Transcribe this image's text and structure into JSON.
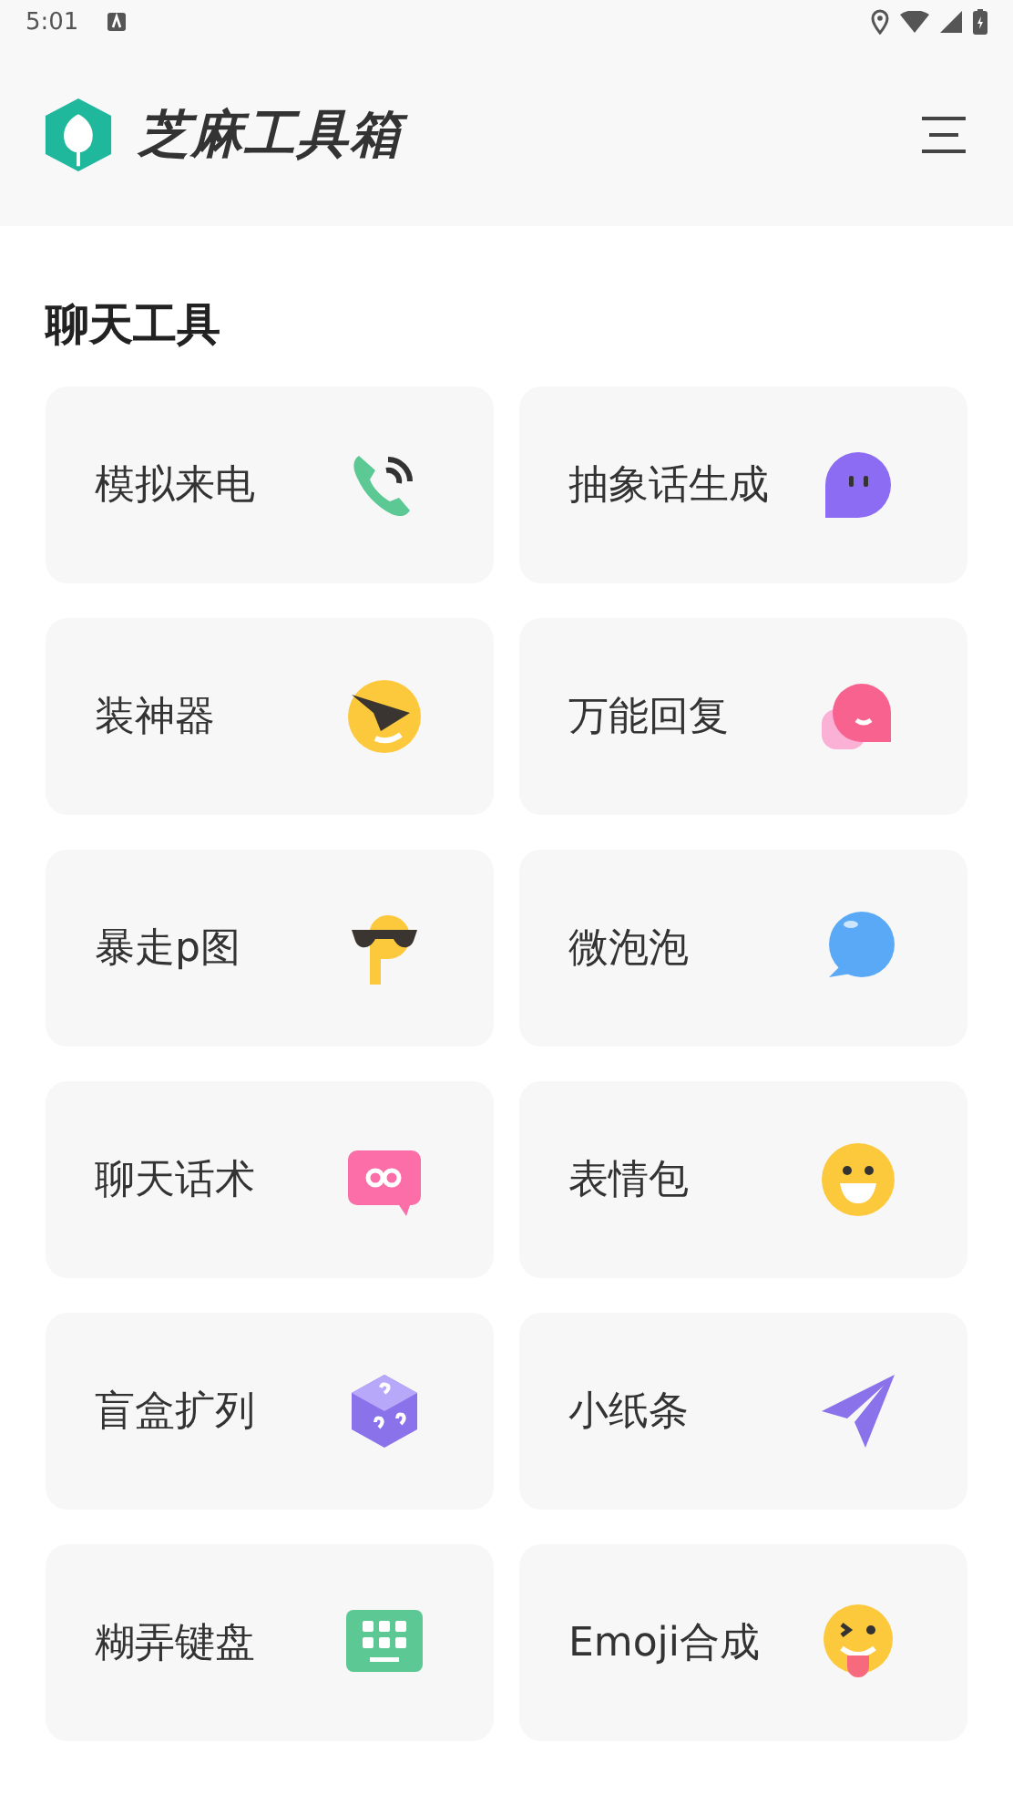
{
  "status_bar": {
    "time": "5:01"
  },
  "app_bar": {
    "title": "芝麻工具箱"
  },
  "section": {
    "title": "聊天工具"
  },
  "tools": [
    {
      "label": "模拟来电",
      "kind": "phone"
    },
    {
      "label": "抽象话生成",
      "kind": "blob"
    },
    {
      "label": "装神器",
      "kind": "cool"
    },
    {
      "label": "万能回复",
      "kind": "chats"
    },
    {
      "label": "暴走p图",
      "kind": "pletter"
    },
    {
      "label": "微泡泡",
      "kind": "bubble"
    },
    {
      "label": "聊天话术",
      "kind": "infinity"
    },
    {
      "label": "表情包",
      "kind": "smile"
    },
    {
      "label": "盲盒扩列",
      "kind": "cube"
    },
    {
      "label": "小纸条",
      "kind": "plane"
    },
    {
      "label": "糊弄键盘",
      "kind": "keyboard"
    },
    {
      "label": "Emoji合成",
      "kind": "tongue"
    }
  ]
}
